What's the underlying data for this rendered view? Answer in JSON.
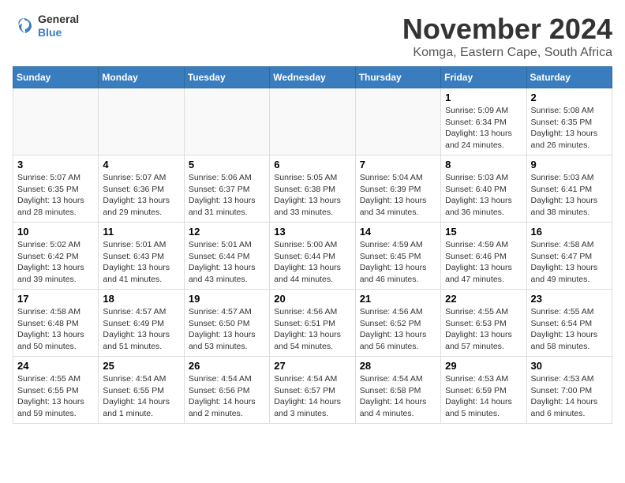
{
  "header": {
    "logo_general": "General",
    "logo_blue": "Blue",
    "month_title": "November 2024",
    "subtitle": "Komga, Eastern Cape, South Africa"
  },
  "weekdays": [
    "Sunday",
    "Monday",
    "Tuesday",
    "Wednesday",
    "Thursday",
    "Friday",
    "Saturday"
  ],
  "weeks": [
    [
      {
        "day": "",
        "info": ""
      },
      {
        "day": "",
        "info": ""
      },
      {
        "day": "",
        "info": ""
      },
      {
        "day": "",
        "info": ""
      },
      {
        "day": "",
        "info": ""
      },
      {
        "day": "1",
        "info": "Sunrise: 5:09 AM\nSunset: 6:34 PM\nDaylight: 13 hours\nand 24 minutes."
      },
      {
        "day": "2",
        "info": "Sunrise: 5:08 AM\nSunset: 6:35 PM\nDaylight: 13 hours\nand 26 minutes."
      }
    ],
    [
      {
        "day": "3",
        "info": "Sunrise: 5:07 AM\nSunset: 6:35 PM\nDaylight: 13 hours\nand 28 minutes."
      },
      {
        "day": "4",
        "info": "Sunrise: 5:07 AM\nSunset: 6:36 PM\nDaylight: 13 hours\nand 29 minutes."
      },
      {
        "day": "5",
        "info": "Sunrise: 5:06 AM\nSunset: 6:37 PM\nDaylight: 13 hours\nand 31 minutes."
      },
      {
        "day": "6",
        "info": "Sunrise: 5:05 AM\nSunset: 6:38 PM\nDaylight: 13 hours\nand 33 minutes."
      },
      {
        "day": "7",
        "info": "Sunrise: 5:04 AM\nSunset: 6:39 PM\nDaylight: 13 hours\nand 34 minutes."
      },
      {
        "day": "8",
        "info": "Sunrise: 5:03 AM\nSunset: 6:40 PM\nDaylight: 13 hours\nand 36 minutes."
      },
      {
        "day": "9",
        "info": "Sunrise: 5:03 AM\nSunset: 6:41 PM\nDaylight: 13 hours\nand 38 minutes."
      }
    ],
    [
      {
        "day": "10",
        "info": "Sunrise: 5:02 AM\nSunset: 6:42 PM\nDaylight: 13 hours\nand 39 minutes."
      },
      {
        "day": "11",
        "info": "Sunrise: 5:01 AM\nSunset: 6:43 PM\nDaylight: 13 hours\nand 41 minutes."
      },
      {
        "day": "12",
        "info": "Sunrise: 5:01 AM\nSunset: 6:44 PM\nDaylight: 13 hours\nand 43 minutes."
      },
      {
        "day": "13",
        "info": "Sunrise: 5:00 AM\nSunset: 6:44 PM\nDaylight: 13 hours\nand 44 minutes."
      },
      {
        "day": "14",
        "info": "Sunrise: 4:59 AM\nSunset: 6:45 PM\nDaylight: 13 hours\nand 46 minutes."
      },
      {
        "day": "15",
        "info": "Sunrise: 4:59 AM\nSunset: 6:46 PM\nDaylight: 13 hours\nand 47 minutes."
      },
      {
        "day": "16",
        "info": "Sunrise: 4:58 AM\nSunset: 6:47 PM\nDaylight: 13 hours\nand 49 minutes."
      }
    ],
    [
      {
        "day": "17",
        "info": "Sunrise: 4:58 AM\nSunset: 6:48 PM\nDaylight: 13 hours\nand 50 minutes."
      },
      {
        "day": "18",
        "info": "Sunrise: 4:57 AM\nSunset: 6:49 PM\nDaylight: 13 hours\nand 51 minutes."
      },
      {
        "day": "19",
        "info": "Sunrise: 4:57 AM\nSunset: 6:50 PM\nDaylight: 13 hours\nand 53 minutes."
      },
      {
        "day": "20",
        "info": "Sunrise: 4:56 AM\nSunset: 6:51 PM\nDaylight: 13 hours\nand 54 minutes."
      },
      {
        "day": "21",
        "info": "Sunrise: 4:56 AM\nSunset: 6:52 PM\nDaylight: 13 hours\nand 56 minutes."
      },
      {
        "day": "22",
        "info": "Sunrise: 4:55 AM\nSunset: 6:53 PM\nDaylight: 13 hours\nand 57 minutes."
      },
      {
        "day": "23",
        "info": "Sunrise: 4:55 AM\nSunset: 6:54 PM\nDaylight: 13 hours\nand 58 minutes."
      }
    ],
    [
      {
        "day": "24",
        "info": "Sunrise: 4:55 AM\nSunset: 6:55 PM\nDaylight: 13 hours\nand 59 minutes."
      },
      {
        "day": "25",
        "info": "Sunrise: 4:54 AM\nSunset: 6:55 PM\nDaylight: 14 hours\nand 1 minute."
      },
      {
        "day": "26",
        "info": "Sunrise: 4:54 AM\nSunset: 6:56 PM\nDaylight: 14 hours\nand 2 minutes."
      },
      {
        "day": "27",
        "info": "Sunrise: 4:54 AM\nSunset: 6:57 PM\nDaylight: 14 hours\nand 3 minutes."
      },
      {
        "day": "28",
        "info": "Sunrise: 4:54 AM\nSunset: 6:58 PM\nDaylight: 14 hours\nand 4 minutes."
      },
      {
        "day": "29",
        "info": "Sunrise: 4:53 AM\nSunset: 6:59 PM\nDaylight: 14 hours\nand 5 minutes."
      },
      {
        "day": "30",
        "info": "Sunrise: 4:53 AM\nSunset: 7:00 PM\nDaylight: 14 hours\nand 6 minutes."
      }
    ]
  ]
}
